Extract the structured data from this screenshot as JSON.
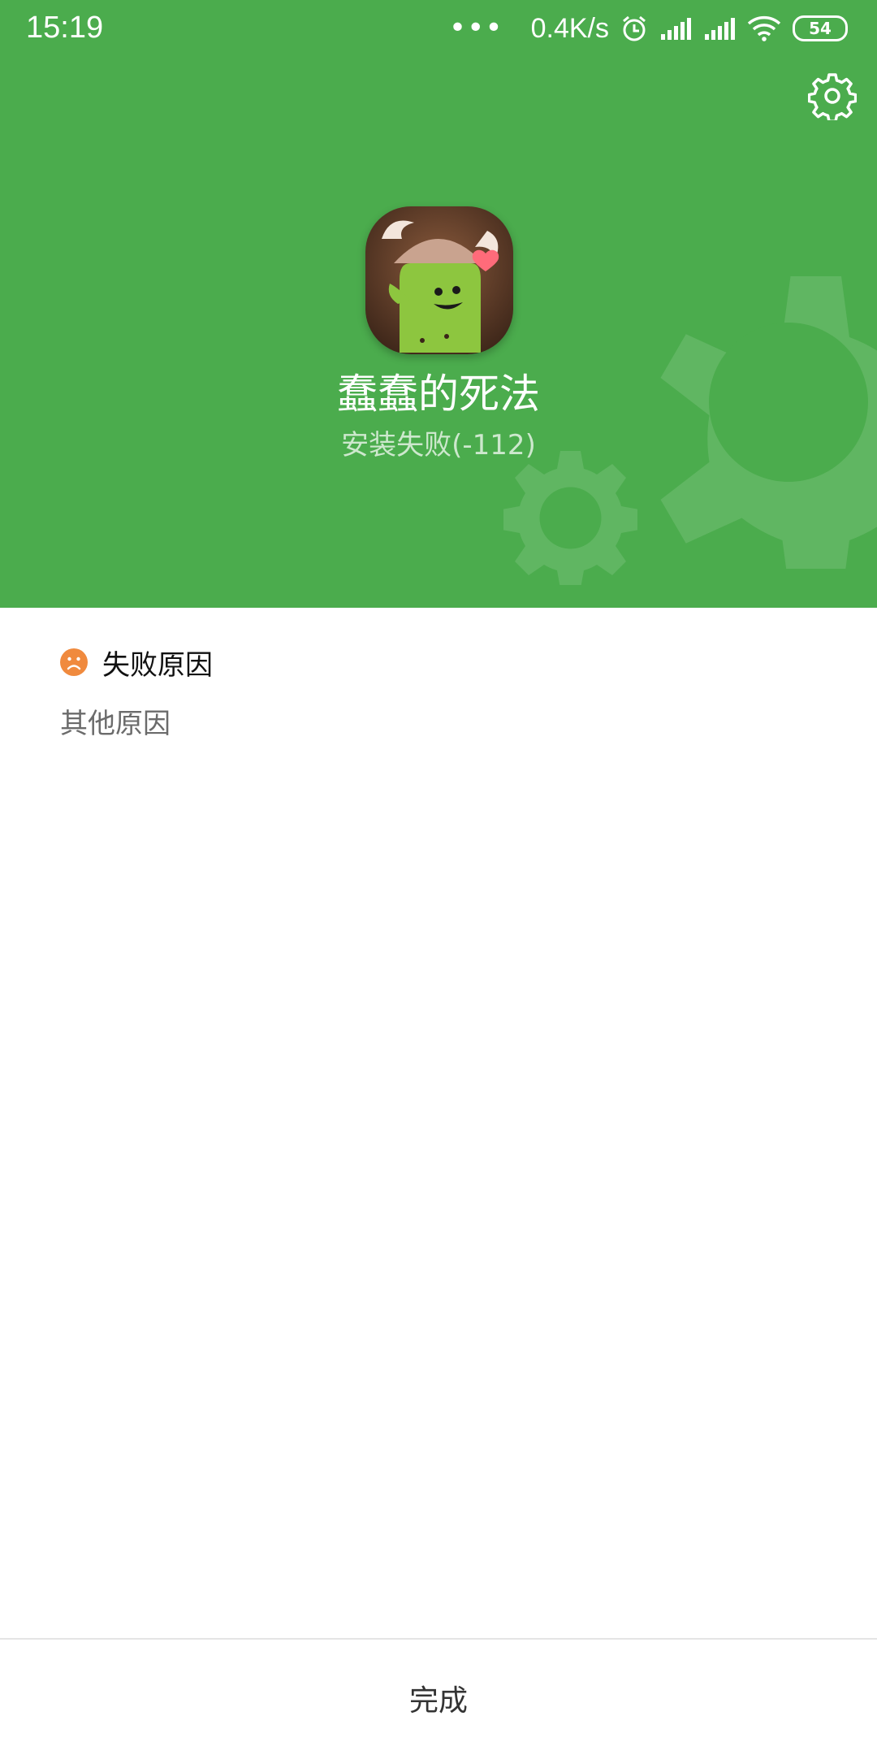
{
  "status_bar": {
    "time": "15:19",
    "more": "•••",
    "net_speed": "0.4K/s",
    "battery": "54",
    "icons": [
      "alarm-icon",
      "signal-icon",
      "signal-icon",
      "wifi-icon",
      "battery-icon"
    ]
  },
  "header": {
    "background_color": "#4bac4d",
    "settings_icon": "gear-icon",
    "app_name": "蠢蠢的死法",
    "status": "安装失败(-112)"
  },
  "failure": {
    "icon": "sad-face-icon",
    "icon_color": "#f08a3e",
    "title": "失败原因",
    "reason": "其他原因"
  },
  "footer": {
    "done_label": "完成"
  }
}
